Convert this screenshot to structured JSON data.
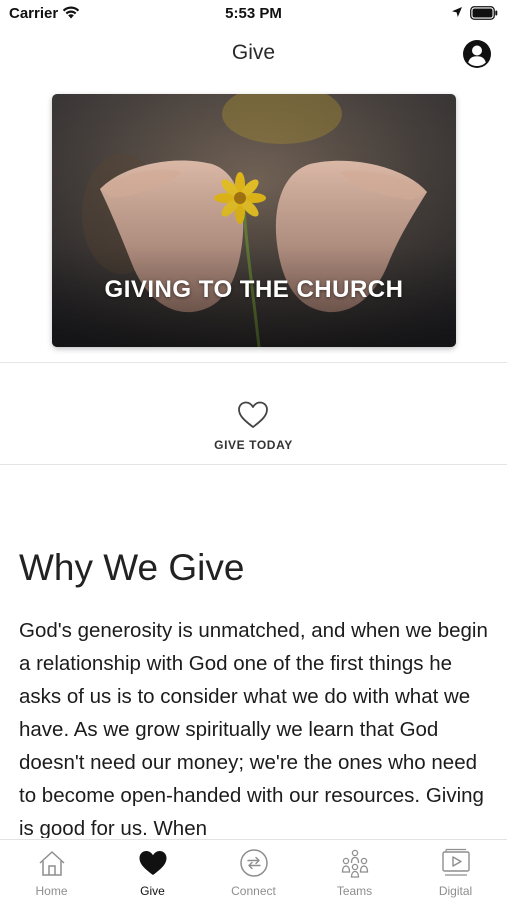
{
  "status_bar": {
    "carrier": "Carrier",
    "time": "5:53 PM"
  },
  "header": {
    "title": "Give",
    "profile_icon": "user-circle-icon"
  },
  "hero": {
    "title": "GIVING TO THE CHURCH",
    "image": "open-hands-holding-yellow-flower"
  },
  "give_today": {
    "label": "GIVE TODAY",
    "icon": "heart-outline-icon"
  },
  "article": {
    "heading": "Why We Give",
    "body": "God's generosity is unmatched, and when we begin a relationship with God one of the first things he asks of us is to consider what we do with what we have. As we grow spiritually we learn that God doesn't need our money; we're the ones who need to become open-handed with our resources. Giving is good for us. When"
  },
  "tabs": [
    {
      "label": "Home",
      "icon": "home-icon",
      "active": false
    },
    {
      "label": "Give",
      "icon": "heart-filled-icon",
      "active": true
    },
    {
      "label": "Connect",
      "icon": "connect-arrows-icon",
      "active": false
    },
    {
      "label": "Teams",
      "icon": "people-icon",
      "active": false
    },
    {
      "label": "Digital",
      "icon": "play-video-icon",
      "active": false
    }
  ],
  "colors": {
    "active_tab": "#111111",
    "inactive_tab": "#8e8e8e",
    "hero_flower": "#f2c51a"
  }
}
